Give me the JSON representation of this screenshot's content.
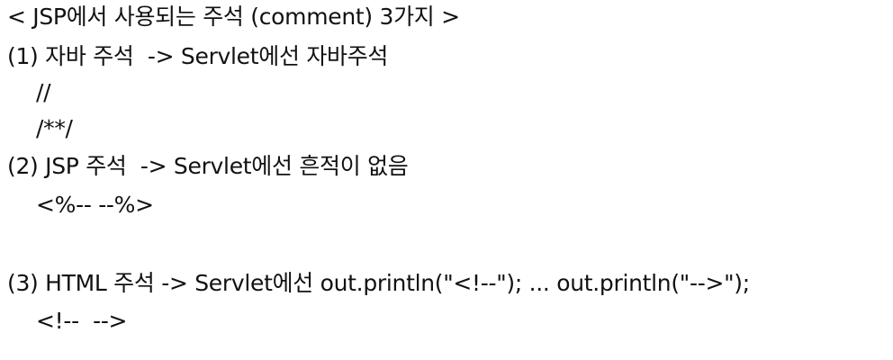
{
  "document": {
    "title": "< JSP에서 사용되는 주석 (comment) 3가지 >",
    "items": [
      {
        "heading": "(1) 자바 주석  -> Servlet에선 자바주석",
        "examples": [
          "//",
          "/**/"
        ]
      },
      {
        "heading": "(2) JSP 주석  -> Servlet에선 흔적이 없음",
        "examples": [
          "<%-- --%>"
        ]
      },
      {
        "heading": "(3) HTML 주석 -> Servlet에선 out.println(\"<!--\"); ... out.println(\"-->\");",
        "examples": [
          "<!--  -->"
        ]
      }
    ]
  }
}
